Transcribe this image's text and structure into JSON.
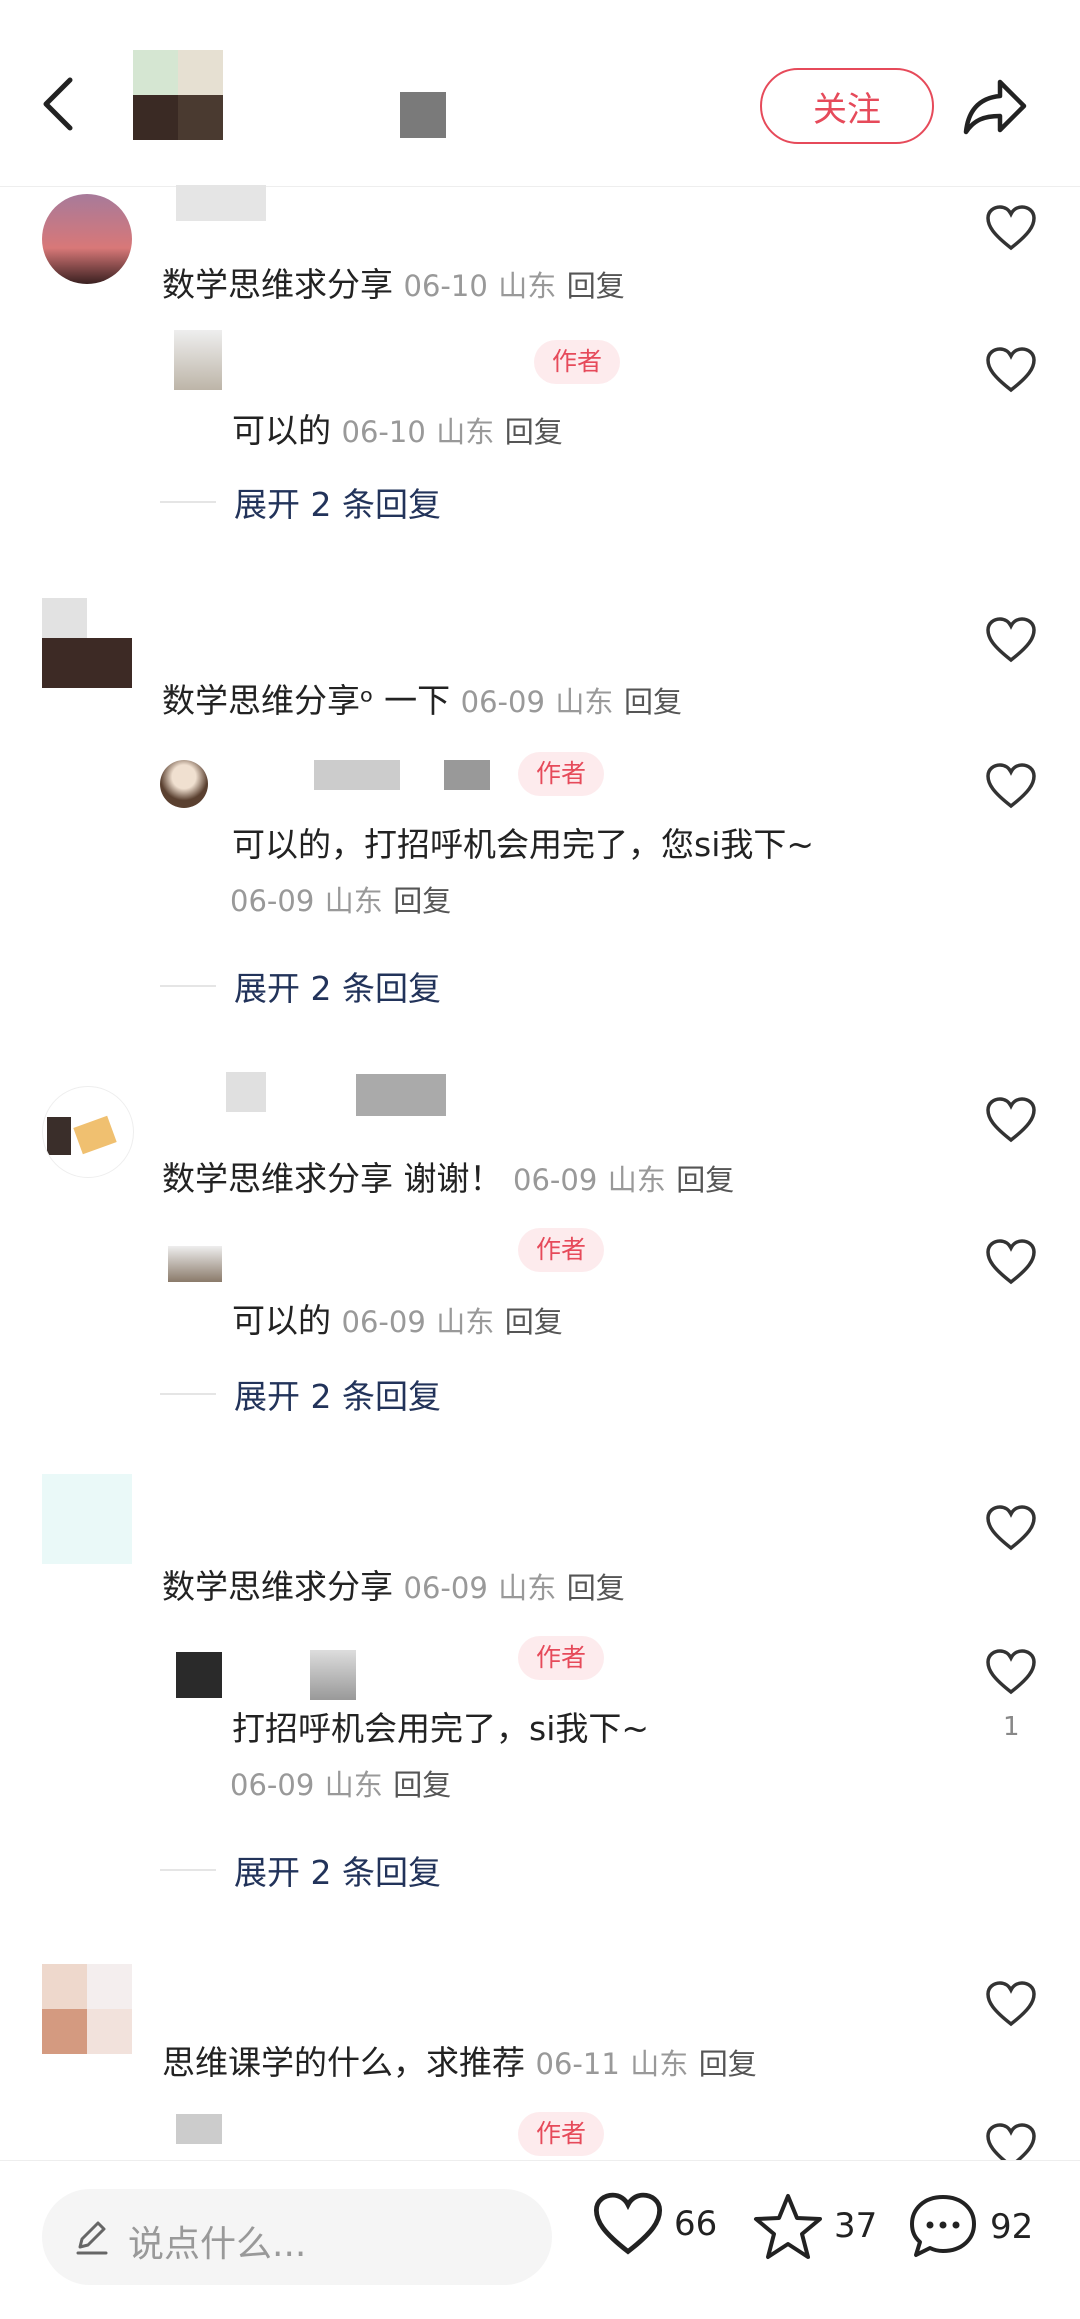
{
  "header": {
    "follow_label": "关注"
  },
  "comments": [
    {
      "text": "数学思维求分享",
      "date": "06-10",
      "location": "山东",
      "reply": "回复",
      "sub_reply": {
        "badge": "作者",
        "text": "可以的",
        "date": "06-10",
        "location": "山东",
        "reply": "回复"
      },
      "expand": "展开 2 条回复"
    },
    {
      "text": "数学思维分享ᵒ 一下",
      "date": "06-09",
      "location": "山东",
      "reply": "回复",
      "sub_reply": {
        "badge": "作者",
        "text": "可以的，打招呼机会用完了，您si我下~",
        "date": "06-09",
        "location": "山东",
        "reply": "回复"
      },
      "expand": "展开 2 条回复"
    },
    {
      "text": "数学思维求分享 谢谢！",
      "date": "06-09",
      "location": "山东",
      "reply": "回复",
      "sub_reply": {
        "badge": "作者",
        "text": "可以的",
        "date": "06-09",
        "location": "山东",
        "reply": "回复"
      },
      "expand": "展开 2 条回复"
    },
    {
      "text": "数学思维求分享",
      "date": "06-09",
      "location": "山东",
      "reply": "回复",
      "sub_reply": {
        "badge": "作者",
        "text": "打招呼机会用完了，si我下~",
        "date": "06-09",
        "location": "山东",
        "reply": "回复",
        "likes": "1"
      },
      "expand": "展开 2 条回复"
    },
    {
      "text": "思维课学的什么，求推荐",
      "date": "06-11",
      "location": "山东",
      "reply": "回复",
      "sub_reply": {
        "badge": "作者"
      }
    }
  ],
  "bottom_bar": {
    "input_placeholder": "说点什么...",
    "likes": "66",
    "favorites": "37",
    "comments": "92"
  },
  "colors": {
    "accent": "#e64a5a",
    "link": "#22335a",
    "meta": "#999999"
  }
}
